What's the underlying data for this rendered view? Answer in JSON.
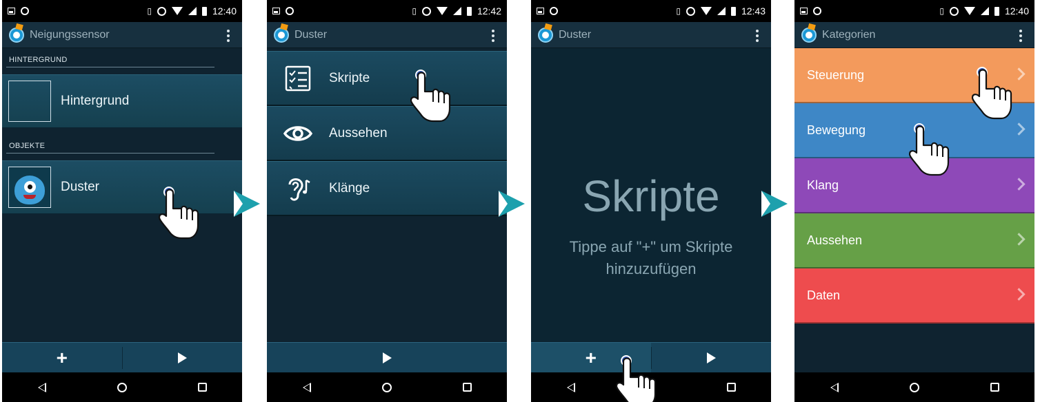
{
  "status_bars": [
    {
      "time": "12:40"
    },
    {
      "time": "12:42"
    },
    {
      "time": "12:43"
    },
    {
      "time": "12:40"
    }
  ],
  "screen1": {
    "title": "Neigungssensor",
    "background_header": "HINTERGRUND",
    "background_item": "Hintergrund",
    "objects_header": "OBJEKTE",
    "object_item": "Duster"
  },
  "screen2": {
    "title": "Duster",
    "items": [
      {
        "label": "Skripte",
        "icon": "scripts-list-icon"
      },
      {
        "label": "Aussehen",
        "icon": "eye-icon"
      },
      {
        "label": "Klänge",
        "icon": "ear-music-icon"
      }
    ]
  },
  "screen3": {
    "title": "Duster",
    "empty_title": "Skripte",
    "empty_hint": "Tippe auf \"+\" um Skripte hinzuzufügen"
  },
  "screen4": {
    "title": "Kategorien",
    "categories": [
      {
        "label": "Steuerung",
        "color": "#f39a5c"
      },
      {
        "label": "Bewegung",
        "color": "#3e87c6"
      },
      {
        "label": "Klang",
        "color": "#8e49b8"
      },
      {
        "label": "Aussehen",
        "color": "#66a047"
      },
      {
        "label": "Daten",
        "color": "#ee4c4e"
      }
    ]
  },
  "colors": {
    "accent_arrow": "#1da0ad",
    "screen_bg": "#0f2330",
    "touch_marker": "#2f57b5"
  }
}
